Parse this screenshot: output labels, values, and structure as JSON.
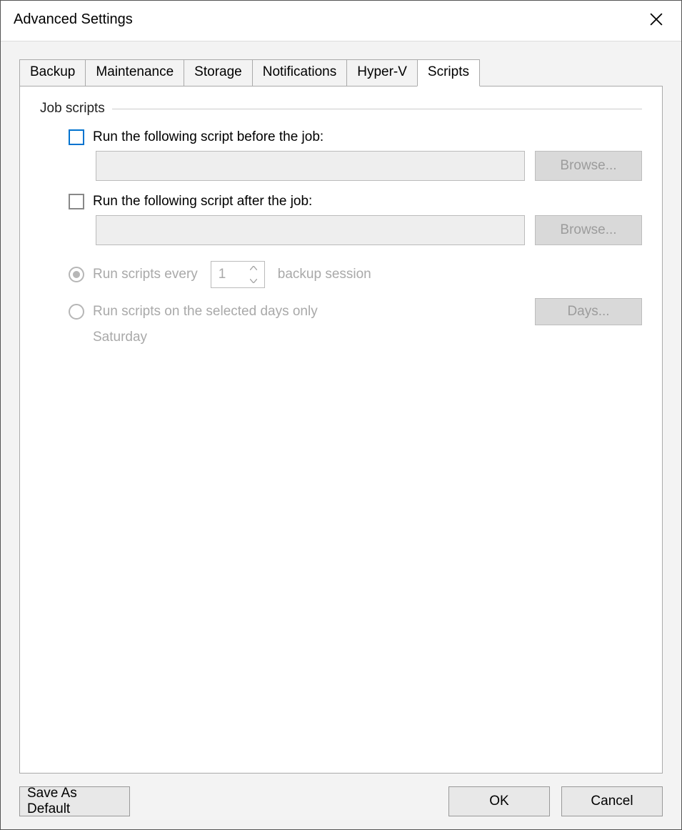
{
  "dialog": {
    "title": "Advanced Settings"
  },
  "tabs": [
    {
      "label": "Backup"
    },
    {
      "label": "Maintenance"
    },
    {
      "label": "Storage"
    },
    {
      "label": "Notifications"
    },
    {
      "label": "Hyper-V"
    },
    {
      "label": "Scripts"
    }
  ],
  "panel": {
    "group_label": "Job scripts",
    "before": {
      "label": "Run the following script before the job:",
      "value": "",
      "browse": "Browse..."
    },
    "after": {
      "label": "Run the following script after the job:",
      "value": "",
      "browse": "Browse..."
    },
    "schedule": {
      "every_prefix": "Run scripts every",
      "every_value": "1",
      "every_suffix": "backup session",
      "days_label": "Run scripts on the selected days only",
      "days_button": "Days...",
      "selected_days": "Saturday"
    }
  },
  "footer": {
    "save_default": "Save As Default",
    "ok": "OK",
    "cancel": "Cancel"
  }
}
